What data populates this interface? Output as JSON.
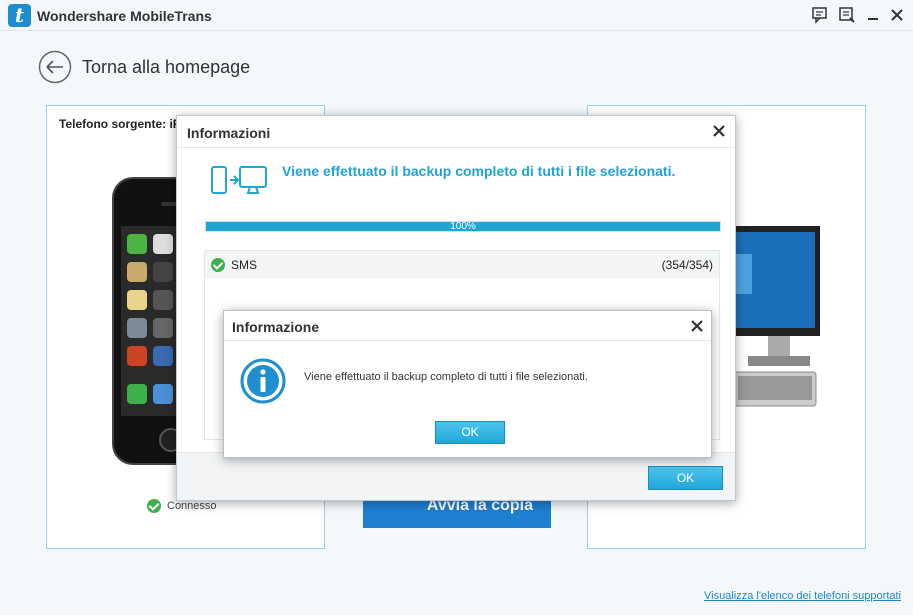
{
  "titlebar": {
    "logo_letter": "t",
    "app_title": "Wondershare MobileTrans",
    "buttons": [
      "feedback-icon",
      "register-icon",
      "minimize-icon",
      "close-icon"
    ]
  },
  "nav": {
    "back_label": "Torna alla homepage"
  },
  "source_panel": {
    "title": "Telefono sorgente: iP",
    "status": "Connesso"
  },
  "start_button": {
    "label": "Avvia la copia"
  },
  "bottom_link": "Visualizza l'elenco dei telefoni supportati",
  "main_dialog": {
    "title": "Informazioni",
    "message": "Viene effettuato il backup completo di tutti i file selezionati.",
    "progress": {
      "percent_label": "100%",
      "value": 1.0
    },
    "items": [
      {
        "name": "SMS",
        "count": "(354/354)"
      }
    ],
    "ok_label": "OK"
  },
  "info_dialog": {
    "title": "Informazione",
    "message": "Viene effettuato il backup completo di tutti i file selezionati.",
    "ok_label": "OK"
  },
  "colors": {
    "accent": "#1fa6d4",
    "button_blue": "#1e7fd3",
    "success_green": "#3cb14a",
    "panel_border": "#9bd4e6"
  }
}
